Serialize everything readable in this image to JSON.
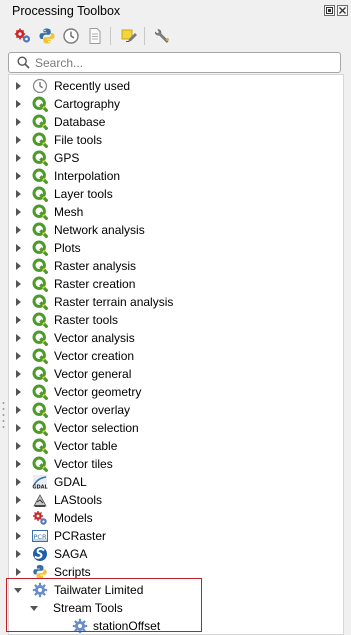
{
  "panel": {
    "title": "Processing Toolbox",
    "float_glyph": "▫",
    "close_glyph": "✕"
  },
  "toolbar": {
    "buttons": [
      {
        "name": "models-button",
        "icon": "gear-cogs-icon"
      },
      {
        "name": "scripts-button",
        "icon": "python-icon"
      },
      {
        "name": "history-button",
        "icon": "clock-icon"
      },
      {
        "name": "results-viewer-button",
        "icon": "document-icon"
      },
      {
        "name": "edit-features-in-place-button",
        "icon": "pencil-highlight-icon"
      },
      {
        "name": "options-button",
        "icon": "wrench-icon"
      }
    ]
  },
  "search": {
    "placeholder": "Search..."
  },
  "tree": {
    "items": [
      {
        "label": "Recently used",
        "icon": "clock-icon",
        "expanded": false
      },
      {
        "label": "Cartography",
        "icon": "qgis-icon",
        "expanded": false
      },
      {
        "label": "Database",
        "icon": "qgis-icon",
        "expanded": false
      },
      {
        "label": "File tools",
        "icon": "qgis-icon",
        "expanded": false
      },
      {
        "label": "GPS",
        "icon": "qgis-icon",
        "expanded": false
      },
      {
        "label": "Interpolation",
        "icon": "qgis-icon",
        "expanded": false
      },
      {
        "label": "Layer tools",
        "icon": "qgis-icon",
        "expanded": false
      },
      {
        "label": "Mesh",
        "icon": "qgis-icon",
        "expanded": false
      },
      {
        "label": "Network analysis",
        "icon": "qgis-icon",
        "expanded": false
      },
      {
        "label": "Plots",
        "icon": "qgis-icon",
        "expanded": false
      },
      {
        "label": "Raster analysis",
        "icon": "qgis-icon",
        "expanded": false
      },
      {
        "label": "Raster creation",
        "icon": "qgis-icon",
        "expanded": false
      },
      {
        "label": "Raster terrain analysis",
        "icon": "qgis-icon",
        "expanded": false
      },
      {
        "label": "Raster tools",
        "icon": "qgis-icon",
        "expanded": false
      },
      {
        "label": "Vector analysis",
        "icon": "qgis-icon",
        "expanded": false
      },
      {
        "label": "Vector creation",
        "icon": "qgis-icon",
        "expanded": false
      },
      {
        "label": "Vector general",
        "icon": "qgis-icon",
        "expanded": false
      },
      {
        "label": "Vector geometry",
        "icon": "qgis-icon",
        "expanded": false
      },
      {
        "label": "Vector overlay",
        "icon": "qgis-icon",
        "expanded": false
      },
      {
        "label": "Vector selection",
        "icon": "qgis-icon",
        "expanded": false
      },
      {
        "label": "Vector table",
        "icon": "qgis-icon",
        "expanded": false
      },
      {
        "label": "Vector tiles",
        "icon": "qgis-icon",
        "expanded": false
      },
      {
        "label": "GDAL",
        "icon": "gdal-icon",
        "expanded": false
      },
      {
        "label": "LAStools",
        "icon": "lastools-icon",
        "expanded": false
      },
      {
        "label": "Models",
        "icon": "models-icon",
        "expanded": false
      },
      {
        "label": "PCRaster",
        "icon": "pcraster-icon",
        "pcr_text": "PCR",
        "expanded": false
      },
      {
        "label": "SAGA",
        "icon": "saga-icon",
        "expanded": false
      },
      {
        "label": "Scripts",
        "icon": "python-icon",
        "expanded": false
      },
      {
        "label": "Tailwater Limited",
        "icon": "provider-gear-icon",
        "expanded": true
      },
      {
        "label": "Stream Tools",
        "icon": "",
        "expanded": true
      },
      {
        "label": "stationOffset",
        "icon": "algorithm-gear-icon",
        "expanded": null
      }
    ]
  },
  "colors": {
    "qgis_green": "#4c9a2a",
    "highlight_border": "#c0202a",
    "provider_blue": "#6b8fc9"
  }
}
